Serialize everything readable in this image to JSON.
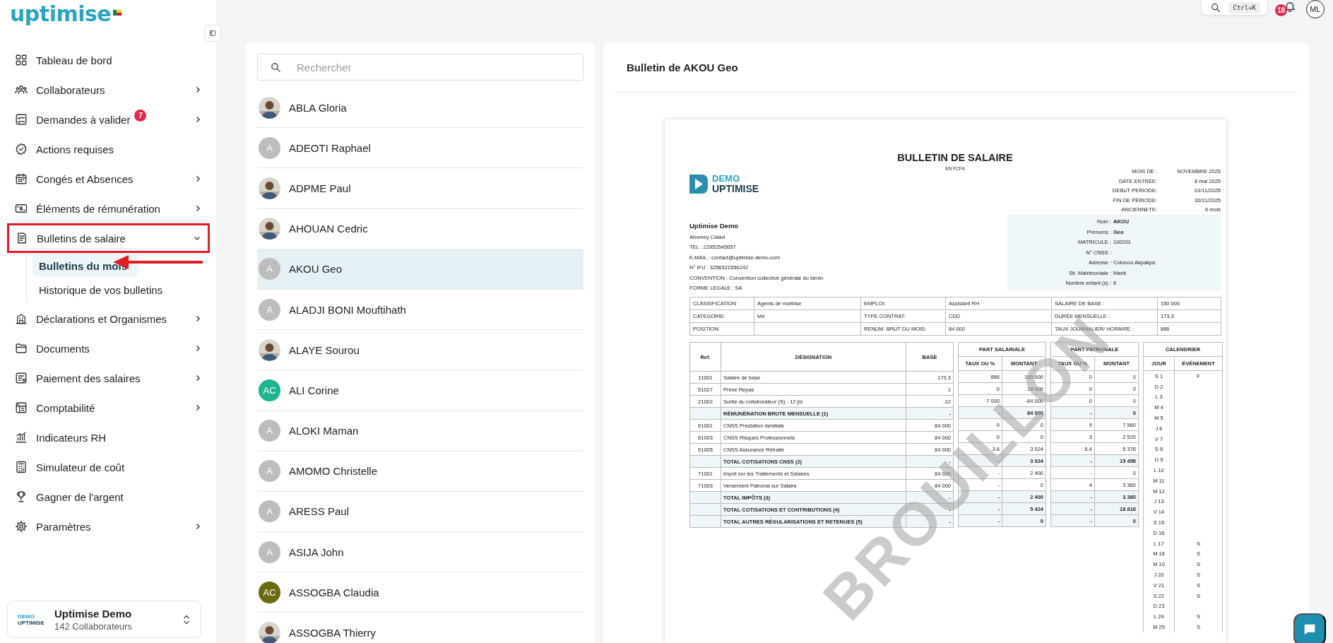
{
  "brand": {
    "name": "uptimise"
  },
  "sidebar": {
    "items": [
      {
        "label": "Tableau de bord",
        "kind": "link",
        "highlighted": false
      },
      {
        "label": "Collaborateurs",
        "kind": "group",
        "expanded": false,
        "highlighted": false
      },
      {
        "label": "Demandes à valider",
        "kind": "group",
        "expanded": false,
        "badge": "7",
        "highlighted": false
      },
      {
        "label": "Actions requises",
        "kind": "link",
        "highlighted": false
      },
      {
        "label": "Congés et Absences",
        "kind": "group",
        "expanded": false,
        "highlighted": false
      },
      {
        "label": "Éléments de rémunération",
        "kind": "group",
        "expanded": false,
        "highlighted": false
      },
      {
        "label": "Bulletins de salaire",
        "kind": "group",
        "expanded": true,
        "highlighted": true,
        "children": [
          {
            "label": "Bulletins du mois",
            "selected": true,
            "pointed": true
          },
          {
            "label": "Historique de vos bulletins",
            "selected": false,
            "pointed": false
          }
        ]
      },
      {
        "label": "Déclarations et Organismes",
        "kind": "group",
        "expanded": false,
        "highlighted": false
      },
      {
        "label": "Documents",
        "kind": "group",
        "expanded": false,
        "highlighted": false
      },
      {
        "label": "Paiement des salaires",
        "kind": "group",
        "expanded": false,
        "highlighted": false
      },
      {
        "label": "Comptabilité",
        "kind": "group",
        "expanded": false,
        "highlighted": false
      },
      {
        "label": "Indicateurs RH",
        "kind": "link",
        "highlighted": false
      },
      {
        "label": "Simulateur de coût",
        "kind": "link",
        "highlighted": false
      },
      {
        "label": "Gagner de l'argent",
        "kind": "link",
        "highlighted": false
      },
      {
        "label": "Paramètres",
        "kind": "group",
        "expanded": false,
        "highlighted": false
      }
    ],
    "company": {
      "logo_line1": "DEMO",
      "logo_line2": "UPTIMISE",
      "name": "Uptimise Demo",
      "subtitle": "142 Collaborateurs"
    }
  },
  "topbar": {
    "search_shortcut": "Ctrl+K",
    "notifications": "18",
    "user_initials": "ML"
  },
  "employees": {
    "search": {
      "placeholder": "Rechercher"
    },
    "items": [
      {
        "name": "ABLA Gloria",
        "selected": false
      },
      {
        "name": "ADEOTI Raphael",
        "avatar": {
          "kind": "initials",
          "text": "A",
          "color": "#bdbdbd"
        },
        "selected": false
      },
      {
        "name": "ADPME Paul",
        "selected": false
      },
      {
        "name": "AHOUAN Cedric",
        "selected": false
      },
      {
        "name": "AKOU Geo",
        "avatar": {
          "kind": "initials",
          "text": "A",
          "color": "#bdbdbd"
        },
        "selected": true
      },
      {
        "name": "ALADJI BONI Mouftihath",
        "avatar": {
          "kind": "initials",
          "text": "A",
          "color": "#bdbdbd"
        },
        "selected": false
      },
      {
        "name": "ALAYE Sourou",
        "selected": false
      },
      {
        "name": "ALI Corine",
        "avatar": {
          "kind": "initials",
          "text": "AC",
          "color": "#1db48f"
        },
        "selected": false
      },
      {
        "name": "ALOKI Maman",
        "avatar": {
          "kind": "initials",
          "text": "A",
          "color": "#bdbdbd"
        },
        "selected": false
      },
      {
        "name": "AMOMO Christelle",
        "avatar": {
          "kind": "initials",
          "text": "A",
          "color": "#bdbdbd"
        },
        "selected": false
      },
      {
        "name": "ARESS Paul",
        "avatar": {
          "kind": "initials",
          "text": "A",
          "color": "#bdbdbd"
        },
        "selected": false
      },
      {
        "name": "ASIJA John",
        "avatar": {
          "kind": "initials",
          "text": "A",
          "color": "#bdbdbd"
        },
        "selected": false
      },
      {
        "name": "ASSOGBA Claudia",
        "avatar": {
          "kind": "initials",
          "text": "AC",
          "color": "#6b6b12"
        },
        "selected": false
      },
      {
        "name": "ASSOGBA Thierry",
        "selected": false
      }
    ]
  },
  "document": {
    "title": "Bulletin de AKOU Geo",
    "payslip": {
      "title": "BULLETIN DE SALAIRE",
      "subtitle": "EN FCFA",
      "logo_line1": "DEMO",
      "logo_line2": "UPTIMISE",
      "stamp": "BROUILLON",
      "period": [
        {
          "label": "MOIS DE :",
          "value": "NOVEMBRE 2025"
        },
        {
          "label": "DATE ENTREE:",
          "value": "8 mai 2025"
        },
        {
          "label": "DEBUT PERIODE:",
          "value": "01/11/2025"
        },
        {
          "label": "FIN DE PÉRIODE:",
          "value": "30/11/2025"
        },
        {
          "label": "ANCIENNETE:",
          "value": "6 mois"
        }
      ],
      "employer": {
        "name": "Uptimise Demo",
        "lines": [
          "Abomey Calavi",
          "TEL : 22952545657",
          "E-MAIL : contact@uptimise-demo.com",
          "N° IFU : 3256321556242",
          "CONVENTION : Convention collective générale du bénin",
          "FORME LEGALE : SA"
        ]
      },
      "employee": [
        {
          "label": "Nom :",
          "value": "AKOU",
          "bold": true
        },
        {
          "label": "Prénoms :",
          "value": "Geo",
          "bold": true
        },
        {
          "label": "MATRICULE :",
          "value": "100201",
          "bold": false
        },
        {
          "label": "N° CNSS :"
        },
        {
          "label": "Adresse :",
          "value": "Cotonou Akpakpa",
          "bold": false
        },
        {
          "label": "Sit. Matrimoniale :",
          "value": "Marié",
          "bold": false
        },
        {
          "label": "Nombre enfant (s) :",
          "value": "6",
          "bold": false
        }
      ],
      "info_rows": [
        [
          "CLASSIFICATION",
          "Agents de maîtrise",
          "EMPLOI:",
          "Assistant RH",
          "SALAIRE DE BASE :",
          "150 000"
        ],
        [
          "CATEGORIE:",
          "M4",
          "TYPE CONTRAT:",
          "CDD",
          "DURÉE MENSUELLE :",
          "173.3"
        ],
        [
          "POSITION:",
          null,
          "RENUM. BRUT DU MOIS:",
          "84 000",
          "TAUX JOURNALIER/ HORAIRE :",
          "866"
        ]
      ],
      "lines": {
        "columns": {
          "ref": "Ref.",
          "designation": "DÉSIGNATION",
          "base": "BASE",
          "employee_part": {
            "title": "PART SALARIALE",
            "rate": "TAUX OU %",
            "amount": "MONTANT"
          },
          "employer_part": {
            "title": "PART PATRONALE",
            "rate": "TAUX OU %",
            "amount": "MONTANT"
          }
        },
        "rows": [
          {
            "kind": "item",
            "ref": "11001",
            "designation": "Salaire de base",
            "base": "173.3",
            "emp_rate": "866",
            "emp_amount": "150 000",
            "er_rate": "0",
            "er_amount": "0"
          },
          {
            "kind": "item",
            "ref": "51027",
            "designation": "Prime Repas",
            "base": "1",
            "emp_rate": "0",
            "emp_amount": "18 000",
            "er_rate": "0",
            "er_amount": "0"
          },
          {
            "kind": "item",
            "ref": "21002",
            "designation": "Sortie du collaborateur (S) - 12 jrs",
            "base": "-12",
            "emp_rate": "7 000",
            "emp_amount": "-84 000",
            "er_rate": "0",
            "er_amount": "0"
          },
          {
            "kind": "total",
            "designation": "RÉMUNÉRATION BRUTE MENSUELLE (1)",
            "base": "-",
            "emp_rate": "-",
            "emp_amount": "84 000",
            "er_rate": "-",
            "er_amount": "0"
          },
          {
            "kind": "item",
            "ref": "61001",
            "designation": "CNSS Prestation familiale",
            "base": "84 000",
            "emp_rate": "0",
            "emp_amount": "0",
            "er_rate": "9",
            "er_amount": "7 560"
          },
          {
            "kind": "item",
            "ref": "61003",
            "designation": "CNSS Risques Professionnels",
            "base": "84 000",
            "emp_rate": "0",
            "emp_amount": "0",
            "er_rate": "3",
            "er_amount": "2 520"
          },
          {
            "kind": "item",
            "ref": "61005",
            "designation": "CNSS Assurance Retraite",
            "base": "84 000",
            "emp_rate": "3.6",
            "emp_amount": "3 024",
            "er_rate": "6.4",
            "er_amount": "5 376"
          },
          {
            "kind": "total",
            "designation": "TOTAL COTISATIONS CNSS (2)",
            "base": "-",
            "emp_rate": "-",
            "emp_amount": "3 024",
            "er_rate": "-",
            "er_amount": "15 456"
          },
          {
            "kind": "item",
            "ref": "71001",
            "designation": "Impôt sur les Traitements et Salaires",
            "base": "84 000",
            "emp_rate": "-",
            "emp_amount": "2 400",
            "er_rate": "-",
            "er_amount": "0"
          },
          {
            "kind": "item",
            "ref": "71003",
            "designation": "Versement Patronal sur Salaire",
            "base": "84 000",
            "emp_rate": "-",
            "emp_amount": "0",
            "er_rate": "4",
            "er_amount": "3 360"
          },
          {
            "kind": "total",
            "designation": "TOTAL IMPÔTS (3)",
            "base": "-",
            "emp_rate": "-",
            "emp_amount": "2 400",
            "er_rate": "-",
            "er_amount": "3 360"
          },
          {
            "kind": "total",
            "designation": "TOTAL COTISATIONS ET CONTRIBUTIONS (4)",
            "base": "-",
            "emp_rate": "-",
            "emp_amount": "5 424",
            "er_rate": "-",
            "er_amount": "18 816"
          },
          {
            "kind": "total",
            "designation": "TOTAL AUTRES RÉGULARISATIONS ET RETENUES (5)",
            "base": "-",
            "emp_rate": "-",
            "emp_amount": "0",
            "er_rate": "-",
            "er_amount": "0"
          }
        ]
      },
      "calendar": {
        "title": "CALENDRIER",
        "day_column": "JOUR",
        "event_column": "ÉVÉNEMENT",
        "days": [
          {
            "day": "S 1",
            "event": "F"
          },
          {
            "day": "D 2"
          },
          {
            "day": "L 3"
          },
          {
            "day": "M 4"
          },
          {
            "day": "M 5"
          },
          {
            "day": "J 6"
          },
          {
            "day": "V 7"
          },
          {
            "day": "S 8"
          },
          {
            "day": "D 9"
          },
          {
            "day": "L 10"
          },
          {
            "day": "M 11"
          },
          {
            "day": "M 12"
          },
          {
            "day": "J 13"
          },
          {
            "day": "V 14"
          },
          {
            "day": "S 15"
          },
          {
            "day": "D 16"
          },
          {
            "day": "L 17",
            "event": "S"
          },
          {
            "day": "M 18",
            "event": "S"
          },
          {
            "day": "M 19",
            "event": "S"
          },
          {
            "day": "J 20",
            "event": "S"
          },
          {
            "day": "V 21",
            "event": "S"
          },
          {
            "day": "S 22",
            "event": "S"
          },
          {
            "day": "D 23"
          },
          {
            "day": "L 24",
            "event": "S"
          },
          {
            "day": "M 25",
            "event": "S"
          }
        ]
      }
    }
  }
}
